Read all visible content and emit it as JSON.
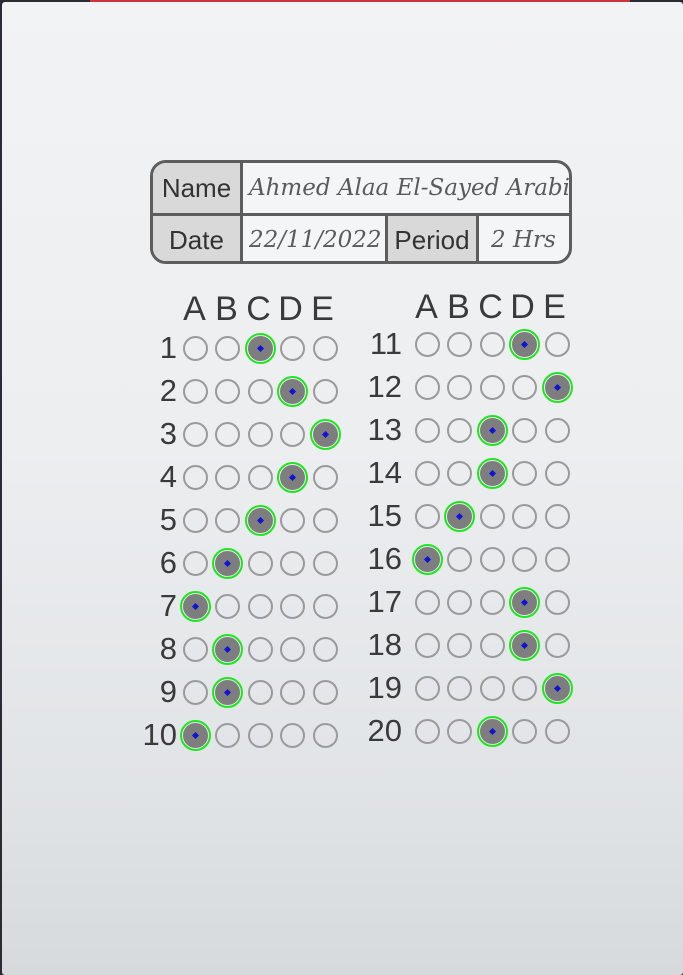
{
  "header": {
    "name_label": "Name",
    "name_value": "Ahmed Alaa El-Sayed Arabi Zidan",
    "date_label": "Date",
    "date_value": "22/11/2022",
    "period_label": "Period",
    "period_value": "2 Hrs"
  },
  "choices": [
    "A",
    "B",
    "C",
    "D",
    "E"
  ],
  "questions": [
    {
      "number": "1",
      "answer": "C"
    },
    {
      "number": "2",
      "answer": "D"
    },
    {
      "number": "3",
      "answer": "E"
    },
    {
      "number": "4",
      "answer": "D"
    },
    {
      "number": "5",
      "answer": "C"
    },
    {
      "number": "6",
      "answer": "B"
    },
    {
      "number": "7",
      "answer": "A"
    },
    {
      "number": "8",
      "answer": "B"
    },
    {
      "number": "9",
      "answer": "B"
    },
    {
      "number": "10",
      "answer": "A"
    },
    {
      "number": "11",
      "answer": "D"
    },
    {
      "number": "12",
      "answer": "E"
    },
    {
      "number": "13",
      "answer": "C"
    },
    {
      "number": "14",
      "answer": "C"
    },
    {
      "number": "15",
      "answer": "B"
    },
    {
      "number": "16",
      "answer": "A"
    },
    {
      "number": "17",
      "answer": "D"
    },
    {
      "number": "18",
      "answer": "D"
    },
    {
      "number": "19",
      "answer": "E"
    },
    {
      "number": "20",
      "answer": "C"
    }
  ],
  "colors": {
    "detection_ring": "#1ee61e",
    "center_marker": "#1313d8",
    "filled_bubble": "#7e7e7e"
  }
}
